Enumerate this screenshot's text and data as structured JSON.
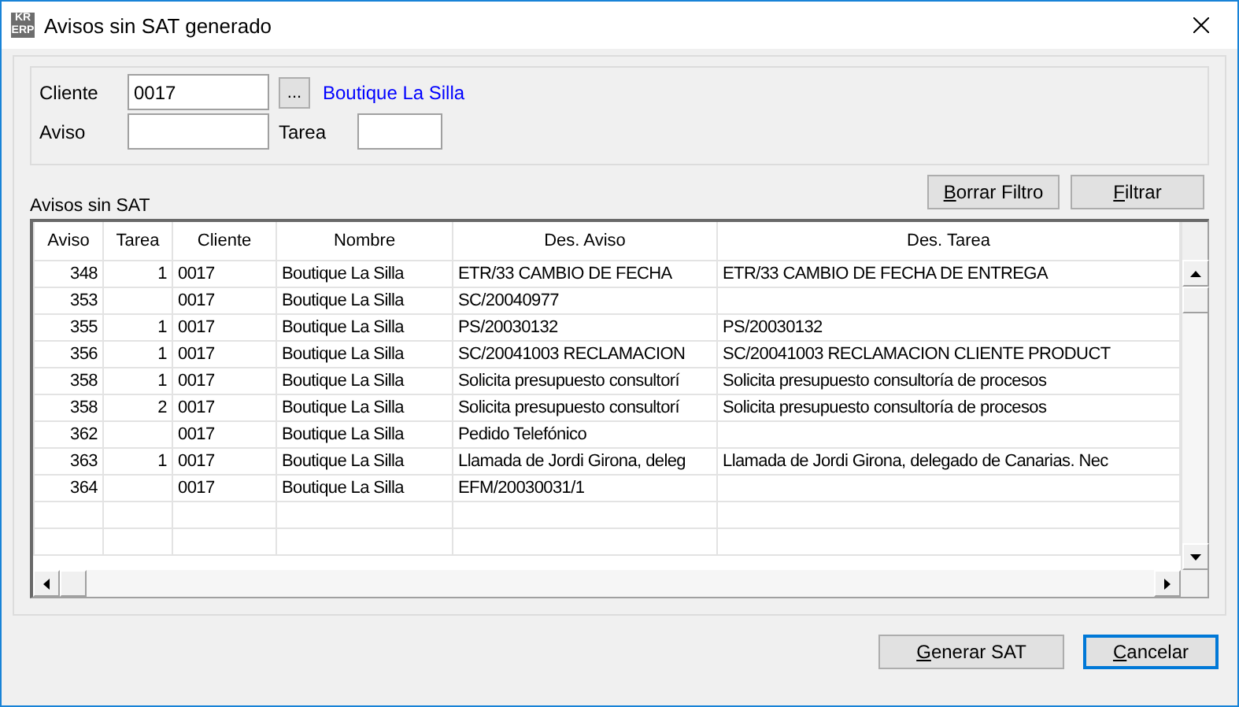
{
  "window": {
    "logo": [
      "KR",
      "ERP"
    ],
    "title": "Avisos sin SAT generado"
  },
  "filter": {
    "cliente_label": "Cliente",
    "cliente_value": "0017",
    "browse_button": "...",
    "cliente_name": "Boutique La Silla",
    "aviso_label": "Aviso",
    "tarea_label": "Tarea"
  },
  "grid_title": "Avisos sin SAT",
  "filter_buttons": [
    {
      "label": "Borrar Filtro",
      "focused": false
    },
    {
      "label": "Filtrar",
      "focused": false
    }
  ],
  "table": {
    "columns": [
      "Aviso",
      "Tarea",
      "Cliente",
      "Nombre",
      "Des. Aviso",
      "Des. Tarea"
    ],
    "rows": [
      [
        "348",
        "1",
        "0017",
        "Boutique La Silla",
        "ETR/33 CAMBIO DE FECHA",
        "ETR/33 CAMBIO DE FECHA DE ENTREGA"
      ],
      [
        "353",
        "",
        "0017",
        "Boutique La Silla",
        "SC/20040977",
        ""
      ],
      [
        "355",
        "1",
        "0017",
        "Boutique La Silla",
        "PS/20030132",
        "PS/20030132"
      ],
      [
        "356",
        "1",
        "0017",
        "Boutique La Silla",
        "SC/20041003 RECLAMACION",
        "SC/20041003 RECLAMACION CLIENTE PRODUCT"
      ],
      [
        "358",
        "1",
        "0017",
        "Boutique La Silla",
        "Solicita presupuesto consultorí",
        "Solicita presupuesto consultoría de procesos"
      ],
      [
        "358",
        "2",
        "0017",
        "Boutique La Silla",
        "Solicita presupuesto consultorí",
        "Solicita presupuesto consultoría de procesos"
      ],
      [
        "362",
        "",
        "0017",
        "Boutique La Silla",
        "Pedido Telefónico",
        ""
      ],
      [
        "363",
        "1",
        "0017",
        "Boutique La Silla",
        "Llamada de Jordi Girona, deleg",
        "Llamada de Jordi Girona, delegado de Canarias. Nec"
      ],
      [
        "364",
        "",
        "0017",
        "Boutique La Silla",
        "EFM/20030031/1",
        ""
      ]
    ]
  },
  "buttons": [
    {
      "label": "Generar SAT",
      "focused": false
    },
    {
      "label": "Cancelar",
      "focused": true
    }
  ]
}
